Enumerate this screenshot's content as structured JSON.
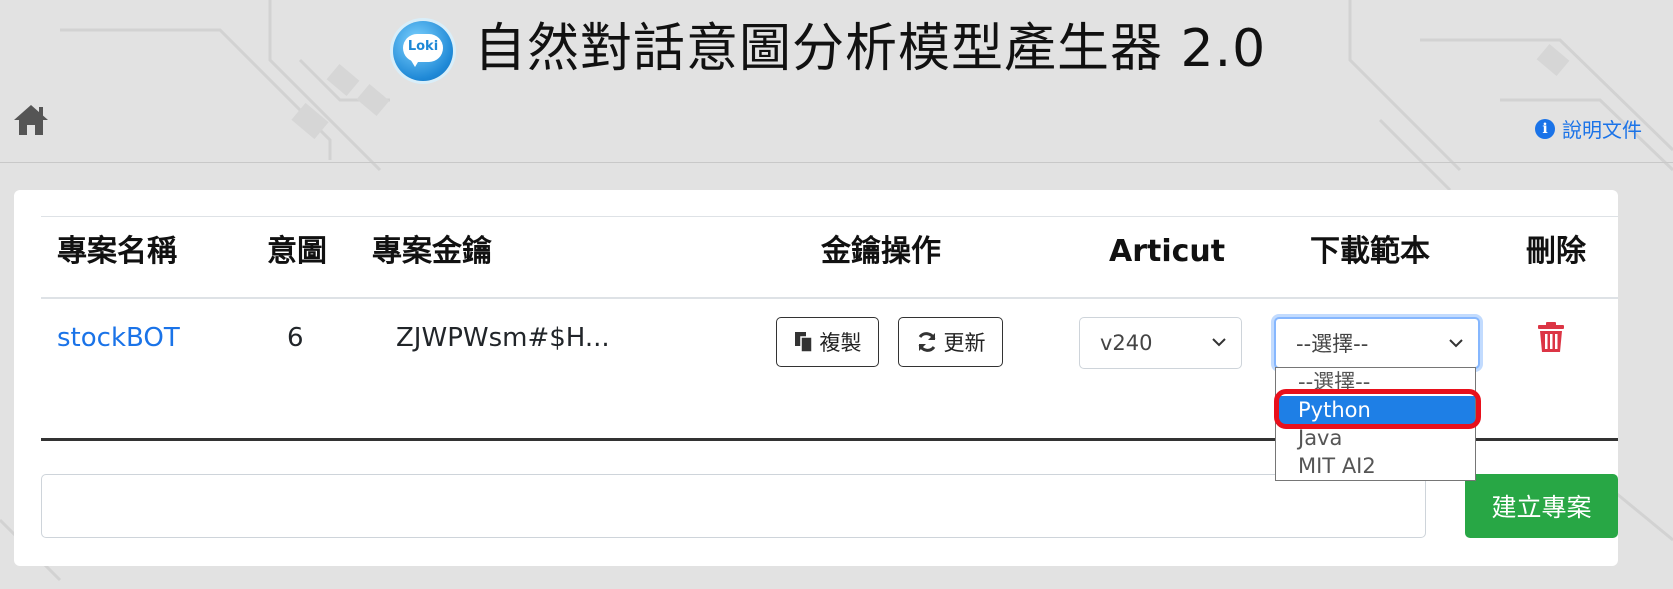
{
  "header": {
    "logo_text": "Loki",
    "title": "自然對話意圖分析模型產生器 2.0",
    "help_label": "說明文件",
    "help_icon": "info-icon",
    "home_icon": "home-icon"
  },
  "table": {
    "columns": [
      "專案名稱",
      "意圖",
      "專案金鑰",
      "金鑰操作",
      "Articut",
      "下載範本",
      "刪除"
    ],
    "rows": [
      {
        "project_name": "stockBOT",
        "intent_count": "6",
        "project_key": "ZJWPWsm#$H...",
        "copy_label": "複製",
        "refresh_label": "更新",
        "articut_version": "v240",
        "download_value": "--選擇--",
        "delete_icon": "trash-icon"
      }
    ]
  },
  "download_dropdown": {
    "options": [
      "--選擇--",
      "Python",
      "Java",
      "MIT AI2"
    ],
    "highlighted": "Python"
  },
  "new_project": {
    "input_value": "",
    "create_label": "建立專案"
  },
  "colors": {
    "link": "#1a73e8",
    "create_button": "#28a745",
    "delete_icon": "#dc3545",
    "dropdown_highlight": "#1e7fe6",
    "annotation_ring": "#e8101c"
  }
}
